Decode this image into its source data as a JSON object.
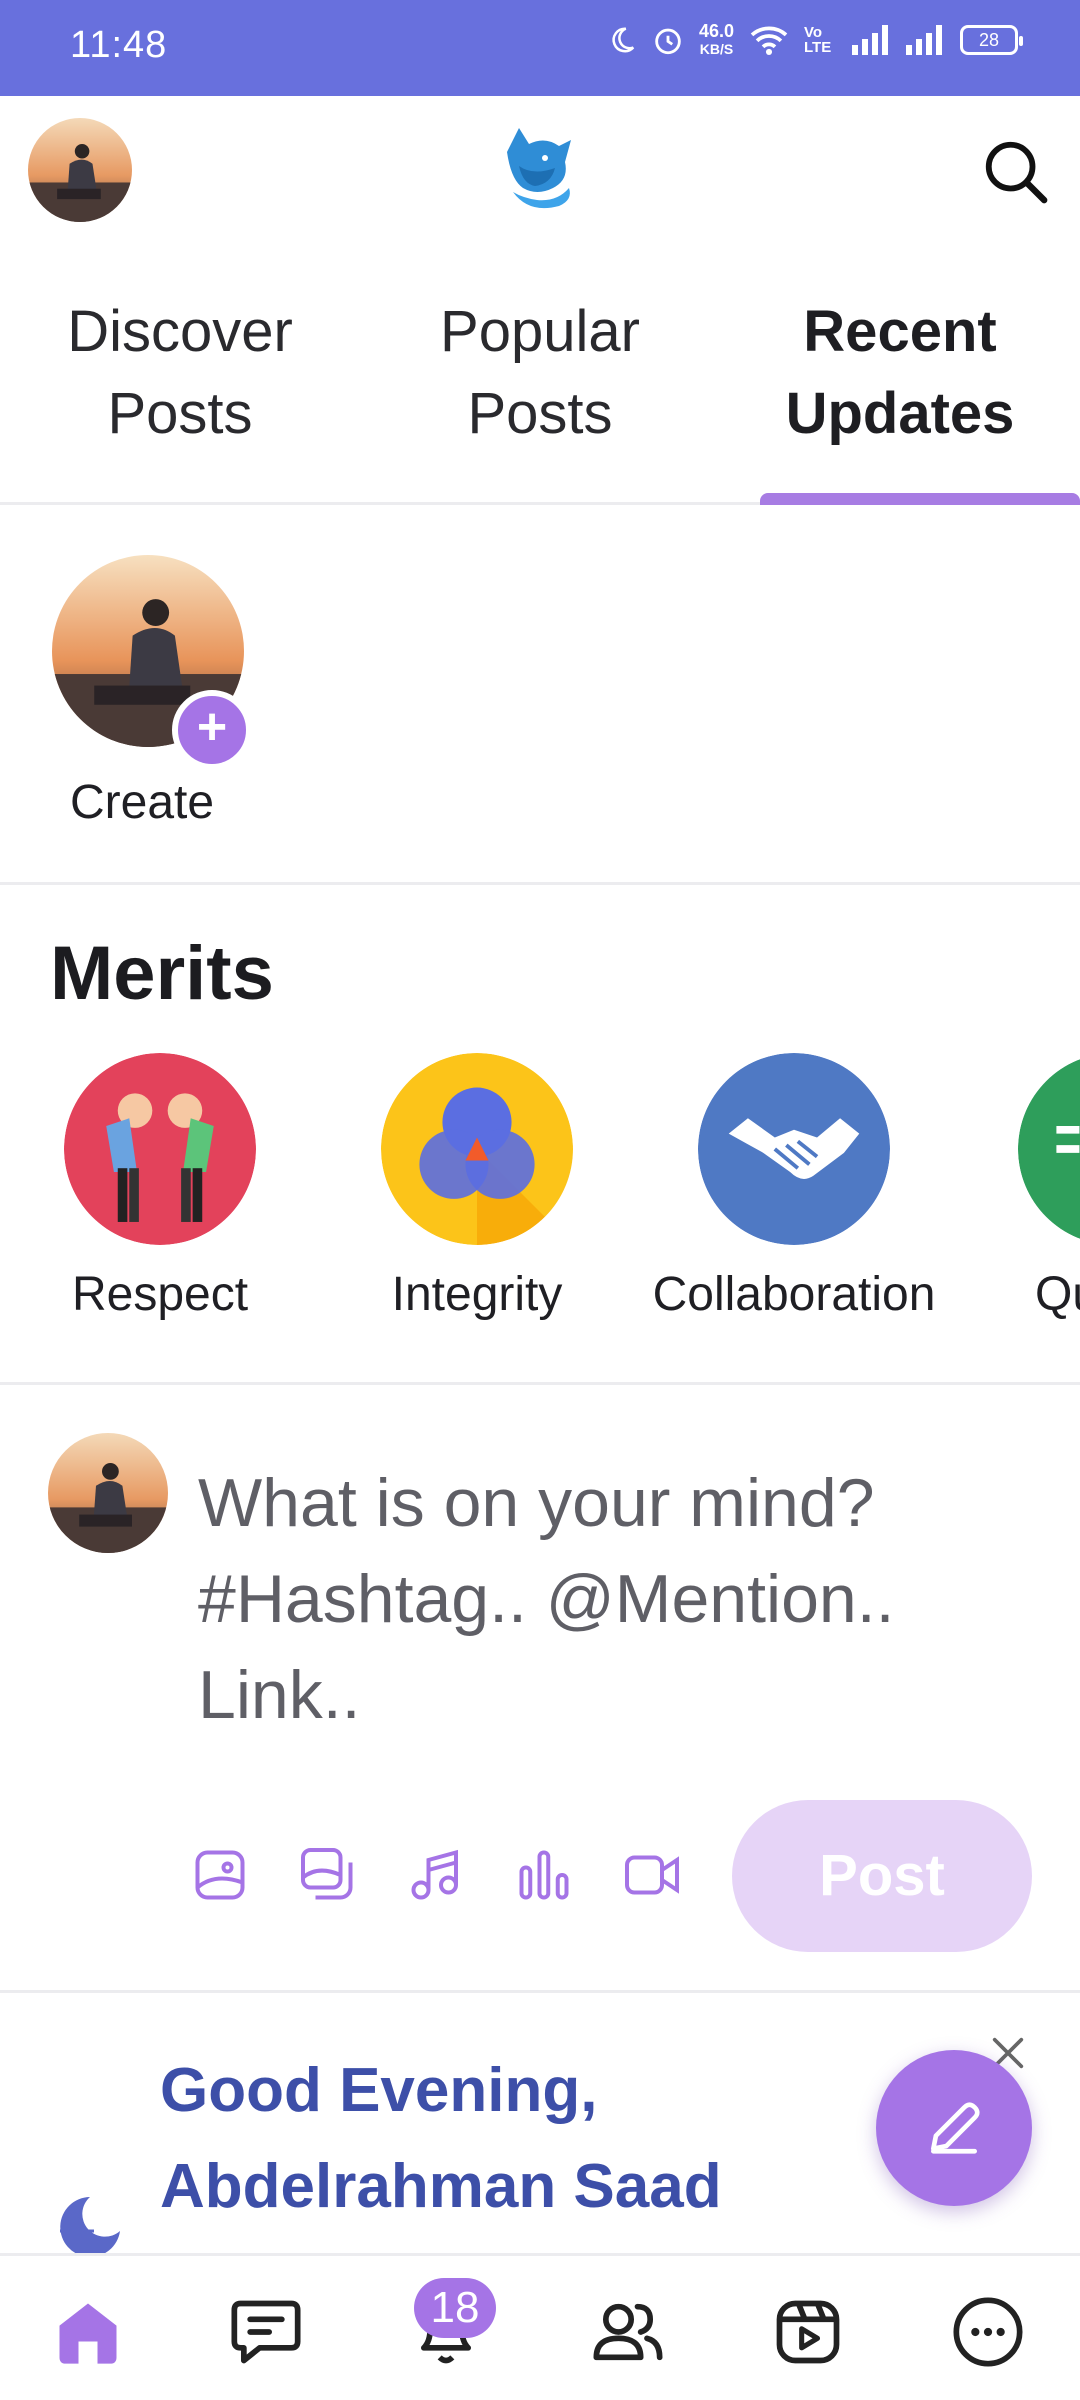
{
  "status_bar": {
    "time": "11:48",
    "net_speed_value": "46.0",
    "net_speed_unit": "KB/S",
    "volte": "Vo LTE",
    "battery": "28"
  },
  "header": {
    "logo_icon": "fox-logo-icon",
    "search_icon": "search-icon"
  },
  "tabs": [
    {
      "label": "Discover Posts",
      "active": false
    },
    {
      "label": "Popular Posts",
      "active": false
    },
    {
      "label": "Recent Updates",
      "active": true
    }
  ],
  "stories": {
    "create_label": "Create"
  },
  "merits": {
    "title": "Merits",
    "items": [
      {
        "label": "Respect",
        "color": "#e3425b"
      },
      {
        "label": "Integrity",
        "color": "#fcc419"
      },
      {
        "label": "Collaboration",
        "color": "#4f79c4"
      },
      {
        "label": "Qu",
        "color": "#2e9e5b"
      }
    ]
  },
  "composer": {
    "placeholder": "What is on your mind? #Hashtag.. @Mention.. Link..",
    "post_label": "Post",
    "tools": [
      "image-icon",
      "gallery-icon",
      "music-icon",
      "poll-icon",
      "video-icon"
    ]
  },
  "greeting": {
    "line1": "Good Evening,",
    "line2": "Abdelrahman Saad"
  },
  "bottom_nav": {
    "notifications_badge": "18",
    "accent": "#a574e6"
  },
  "colors": {
    "status_bar": "#6870dd",
    "accent": "#a574e6",
    "greeting": "#3d4fa8"
  }
}
